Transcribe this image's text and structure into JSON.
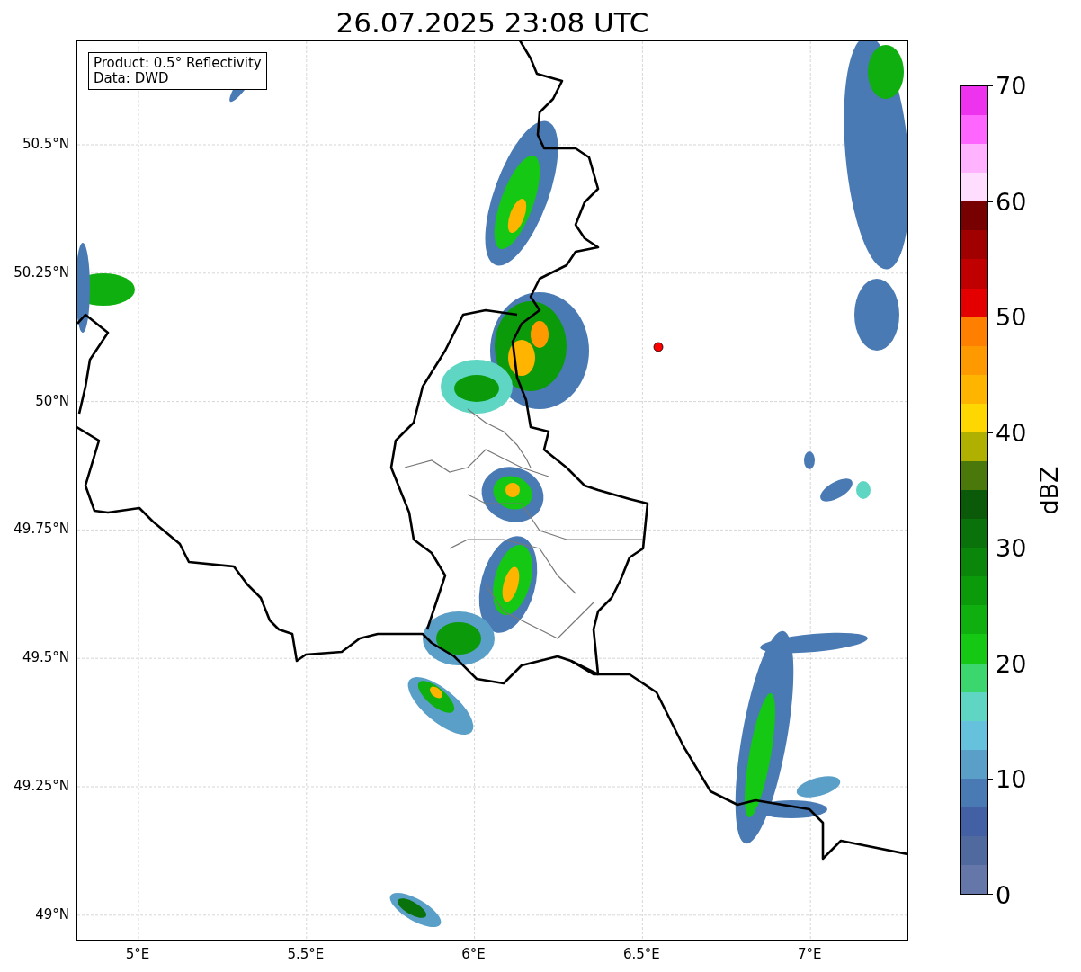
{
  "title": "26.07.2025 23:08 UTC",
  "legend_box": {
    "lines": [
      "Product: 0.5° Reflectivity",
      "Data: DWD"
    ]
  },
  "map": {
    "y_ticks": [
      "50.5°N",
      "50.25°N",
      "50°N",
      "49.75°N",
      "49.5°N",
      "49.25°N",
      "49°N"
    ],
    "x_ticks": [
      "5°E",
      "5.5°E",
      "6°E",
      "6.5°E",
      "7°E"
    ]
  },
  "colorbar": {
    "label": "dBZ",
    "ticks": [
      "70",
      "60",
      "50",
      "40",
      "30",
      "20",
      "10",
      "0"
    ],
    "segments": [
      {
        "color": "#ee33ee"
      },
      {
        "color": "#ff66ff"
      },
      {
        "color": "#ffb3ff"
      },
      {
        "color": "#ffddff"
      },
      {
        "color": "#770000"
      },
      {
        "color": "#a00000"
      },
      {
        "color": "#c00000"
      },
      {
        "color": "#e40000"
      },
      {
        "color": "#ff7f00"
      },
      {
        "color": "#ff9900"
      },
      {
        "color": "#ffb400"
      },
      {
        "color": "#ffd700"
      },
      {
        "color": "#b0b000"
      },
      {
        "color": "#4a780a"
      },
      {
        "color": "#0a5a0a"
      },
      {
        "color": "#0a720a"
      },
      {
        "color": "#0a860a"
      },
      {
        "color": "#0a9a0a"
      },
      {
        "color": "#0faf0f"
      },
      {
        "color": "#14c814"
      },
      {
        "color": "#3cd66e"
      },
      {
        "color": "#5ed6c3"
      },
      {
        "color": "#66c2dc"
      },
      {
        "color": "#5a9fc8"
      },
      {
        "color": "#4a7ab4"
      },
      {
        "color": "#4460a4"
      },
      {
        "color": "#506aa0"
      },
      {
        "color": "#6477a8"
      }
    ]
  }
}
